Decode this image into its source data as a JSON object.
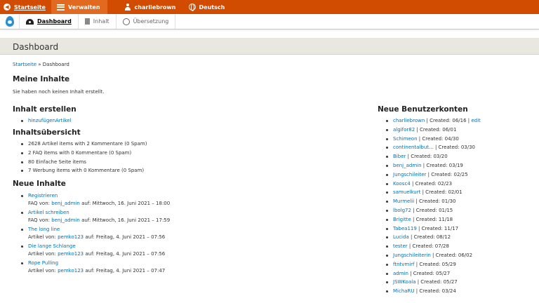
{
  "toolbar": {
    "home": "Startseite",
    "manage": "Verwalten",
    "user": "charliebrown",
    "language": "Deutsch"
  },
  "tabs": [
    {
      "label": "Dashboard"
    },
    {
      "label": "Inhalt"
    },
    {
      "label": "Übersetzung"
    }
  ],
  "page": {
    "title": "Dashboard",
    "breadcrumb_home": "Startseite",
    "breadcrumb_sep": " » ",
    "breadcrumb_current": "Dashboard"
  },
  "my_content": {
    "heading": "Meine Inhalte",
    "empty": "Sie haben noch keinen Inhalt erstellt."
  },
  "create": {
    "heading": "Inhalt erstellen",
    "items": [
      "hinzufügenArtikel"
    ]
  },
  "overview": {
    "heading": "Inhaltsübersicht",
    "items": [
      "2628 Artikel items with 2 Kommentare (0 Spam)",
      "2 FAQ items with 0 Kommentare (0 Spam)",
      "80 Einfache Seite items",
      "7 Werbung items with 0 Kommentare (0 Spam)"
    ]
  },
  "new_content": {
    "heading": "Neue Inhalte",
    "items": [
      {
        "title": "Registrieren",
        "type": "FAQ von:",
        "author": "benj_admin",
        "date": "auf: Mittwoch, 16. Juni 2021 – 18:00"
      },
      {
        "title": "Artikel schreiben",
        "type": "FAQ von:",
        "author": "benj_admin",
        "date": "auf: Mittwoch, 16. Juni 2021 – 17:59"
      },
      {
        "title": "The long line",
        "type": "Artikel von:",
        "author": "pemko123",
        "date": "auf: Freitag, 4. Juni 2021 – 07:56"
      },
      {
        "title": "Die lange Schlange",
        "type": "Artikel von:",
        "author": "pemko123",
        "date": "auf: Freitag, 4. Juni 2021 – 07:56"
      },
      {
        "title": "Rope Pulling",
        "type": "Artikel von:",
        "author": "pemko123",
        "date": "auf: Freitag, 4. Juni 2021 – 07:47"
      }
    ]
  },
  "new_accounts": {
    "heading": "Neue Benutzerkonten",
    "edit_label": "edit",
    "items": [
      {
        "name": "charliebrown",
        "created": "Created: 06/16"
      },
      {
        "name": "algifor82",
        "created": "Created: 06/01"
      },
      {
        "name": "Schimeon",
        "created": "Created: 04/30"
      },
      {
        "name": "continentalbut...",
        "created": "Created: 03/30"
      },
      {
        "name": "Biber",
        "created": "Created: 03/20"
      },
      {
        "name": "benj_admin",
        "created": "Created: 03/19"
      },
      {
        "name": "Jungschileiter",
        "created": "Created: 02/25"
      },
      {
        "name": "Koosc4",
        "created": "Created: 02/23"
      },
      {
        "name": "samuelkurt",
        "created": "Created: 02/01"
      },
      {
        "name": "Murmelii",
        "created": "Created: 01/30"
      },
      {
        "name": "lbolg72",
        "created": "Created: 01/15"
      },
      {
        "name": "Brigitte",
        "created": "Created: 11/18"
      },
      {
        "name": "Tabea119",
        "created": "Created: 11/17"
      },
      {
        "name": "Lucida",
        "created": "Created: 08/12"
      },
      {
        "name": "tester",
        "created": "Created: 07/28"
      },
      {
        "name": "Jungschileiterin",
        "created": "Created: 06/02"
      },
      {
        "name": "ftntvmirf",
        "created": "Created: 05/29"
      },
      {
        "name": "admin",
        "created": "Created: 05/27"
      },
      {
        "name": "JSWKoala",
        "created": "Created: 05/27"
      },
      {
        "name": "MichaRU",
        "created": "Created: 03/24"
      }
    ]
  },
  "colors": {
    "toolbar": "#d14b00",
    "link": "#0071b3",
    "header_bg": "#e9e8e0"
  }
}
